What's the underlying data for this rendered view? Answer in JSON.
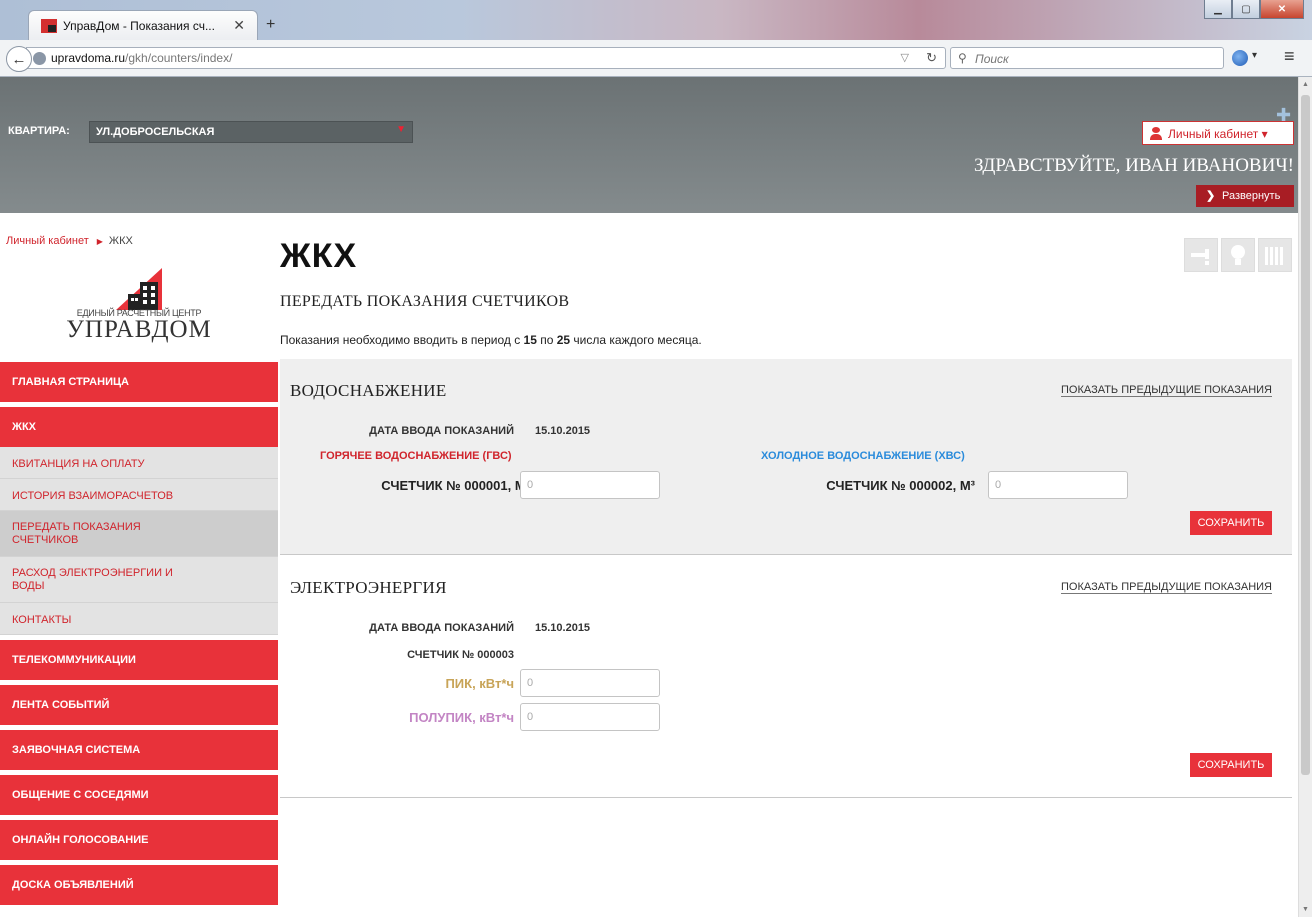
{
  "browser": {
    "tab_title": "УправДом - Показания сч...",
    "url_domain": "upravdoma.ru",
    "url_path": "/gkh/counters/index/",
    "search_placeholder": "Поиск"
  },
  "header": {
    "apartment_label": "КВАРТИРА:",
    "apartment_value": "УЛ.ДОБРОСЕЛЬСКАЯ",
    "cabinet_button": "Личный кабинет ▾",
    "greeting": "ЗДРАВСТВУЙТЕ, ИВАН ИВАНОВИЧ!",
    "expand_button": "Развернуть"
  },
  "breadcrumb": {
    "home": "Личный кабинет",
    "current": "ЖКХ"
  },
  "logo": {
    "tagline": "ЕДИНЫЙ РАСЧЕТНЫЙ ЦЕНТР",
    "brand": "УПРАВДОМ"
  },
  "sidebar": {
    "main1": [
      "ГЛАВНАЯ СТРАНИЦА",
      "ЖКХ"
    ],
    "sub": [
      {
        "label": "КВИТАНЦИЯ НА ОПЛАТУ"
      },
      {
        "label": "ИСТОРИЯ ВЗАИМОРАСЧЕТОВ"
      },
      {
        "label": "ПЕРЕДАТЬ ПОКАЗАНИЯ\nСЧЕТЧИКОВ"
      },
      {
        "label": "РАСХОД ЭЛЕКТРОЭНЕРГИИ И\nВОДЫ"
      },
      {
        "label": "КОНТАКТЫ"
      }
    ],
    "main2": [
      "ТЕЛЕКОММУНИКАЦИИ",
      "ЛЕНТА СОБЫТИЙ",
      "ЗАЯВОЧНАЯ СИСТЕМА",
      "ОБЩЕНИЕ С СОСЕДЯМИ",
      "ОНЛАЙН ГОЛОСОВАНИЕ",
      "ДОСКА ОБЪЯВЛЕНИЙ"
    ]
  },
  "main": {
    "title": "ЖКХ",
    "subtitle": "ПЕРЕДАТЬ ПОКАЗАНИЯ СЧЕТЧИКОВ",
    "note_before": "Показания необходимо вводить в период с ",
    "note_from": "15",
    "note_mid": " по ",
    "note_to": "25",
    "note_after": " числа каждого месяца."
  },
  "water": {
    "title": "ВОДОСНАБЖЕНИЕ",
    "prev_link": "ПОКАЗАТЬ ПРЕДЫДУЩИЕ ПОКАЗАНИЯ",
    "date_label": "ДАТА ВВОДА ПОКАЗАНИЙ",
    "date_value": "15.10.2015",
    "hot_label": "ГОРЯЧЕЕ ВОДОСНАБЖЕНИЕ (ГВС)",
    "cold_label": "ХОЛОДНОЕ ВОДОСНАБЖЕНИЕ (ХВС)",
    "hot_meter": "СЧЕТЧИК № 000001, М³",
    "cold_meter": "СЧЕТЧИК № 000002, М³",
    "hot_placeholder": "0",
    "cold_placeholder": "0",
    "save": "СОХРАНИТЬ"
  },
  "electricity": {
    "title": "ЭЛЕКТРОЭНЕРГИЯ",
    "prev_link": "ПОКАЗАТЬ ПРЕДЫДУЩИЕ ПОКАЗАНИЯ",
    "date_label": "ДАТА ВВОДА ПОКАЗАНИЙ",
    "date_value": "15.10.2015",
    "meter": "СЧЕТЧИК № 000003",
    "peak_label": "ПИК, кВт*ч",
    "semipeak_label": "ПОЛУПИК, кВт*ч",
    "peak_placeholder": "0",
    "semipeak_placeholder": "0",
    "save": "СОХРАНИТЬ"
  }
}
